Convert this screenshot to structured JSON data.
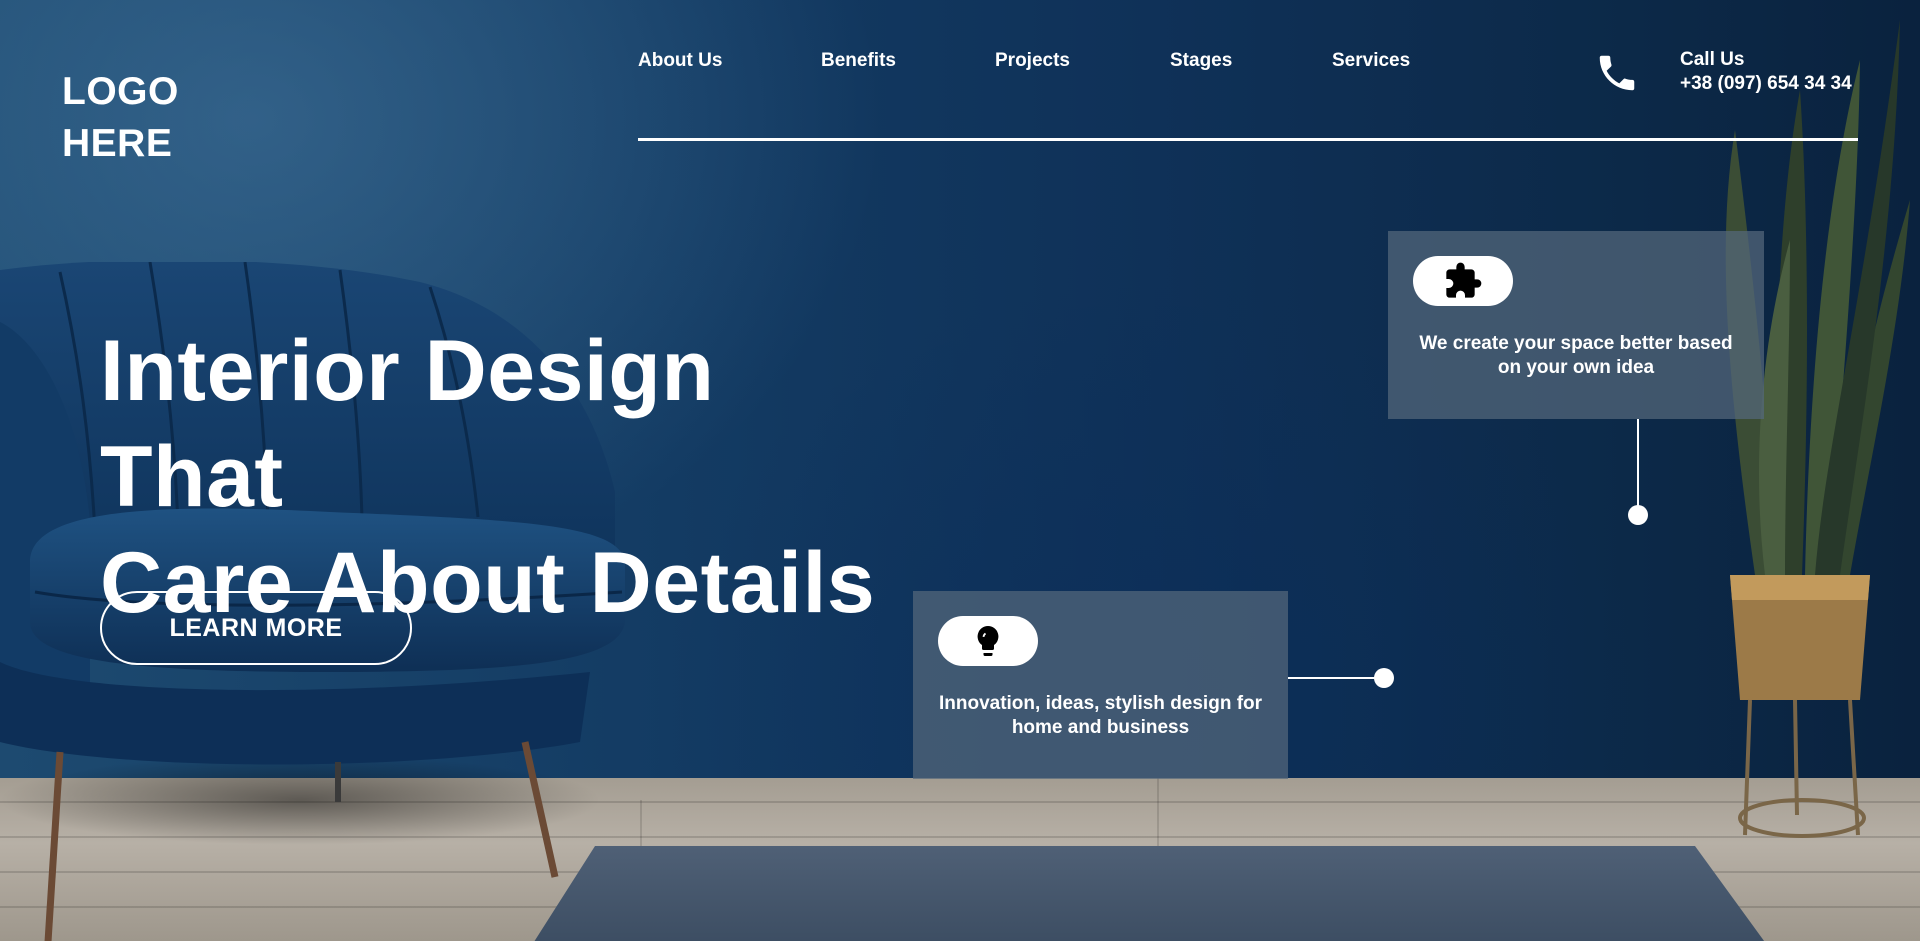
{
  "header": {
    "logo_line1": "LOGO",
    "logo_line2": "HERE",
    "nav": [
      "About Us",
      "Benefits",
      "Projects",
      "Stages",
      "Services"
    ],
    "call_title": "Call Us",
    "call_number": "+38 (097) 654 34 34"
  },
  "hero": {
    "title_line1": "Interior Design That",
    "title_line2": "Care About Details",
    "button_label": "LEARN MORE"
  },
  "cards": [
    {
      "icon": "puzzle-icon",
      "text_line1": "We create your space better based",
      "text_line2": "on your own idea"
    },
    {
      "icon": "lightbulb-icon",
      "text_line1": "Innovation, ideas, stylish design for",
      "text_line2": "home and business"
    }
  ],
  "colors": {
    "wall": "#133b63",
    "card_bg": "#54687c",
    "chair": "#163e66",
    "floor": "#b7b0a6"
  }
}
